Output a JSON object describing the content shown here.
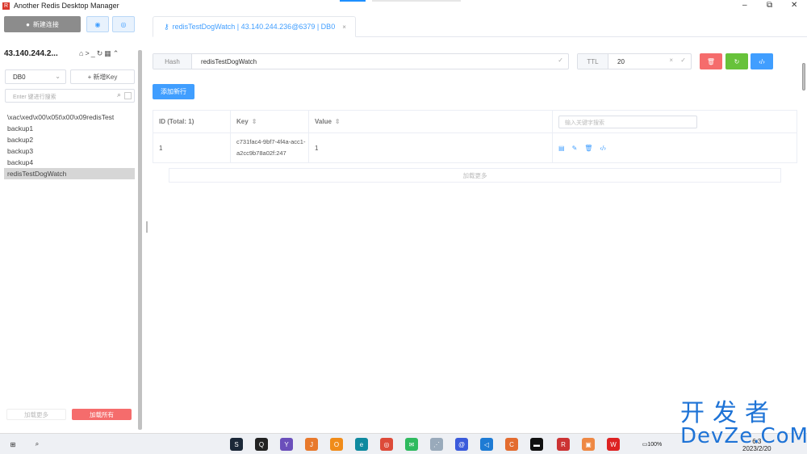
{
  "window": {
    "title": "Another Redis Desktop Manager",
    "app_icon": "redis-logo-icon"
  },
  "window_controls": {
    "minimize": "–",
    "maximize": "⧉",
    "close": "✕"
  },
  "sidebar": {
    "new_connection_label": "新建连接",
    "connection_name": "43.140.244.2...",
    "db_select": {
      "value": "DB0"
    },
    "new_key_label": "+ 新增Key",
    "key_search": {
      "placeholder": "Enter 键进行搜索"
    },
    "keys": [
      {
        "label": "\\xac\\xed\\x00\\x05t\\x00\\x09redisTest",
        "active": false
      },
      {
        "label": "backup1",
        "active": false
      },
      {
        "label": "backup2",
        "active": false
      },
      {
        "label": "backup3",
        "active": false
      },
      {
        "label": "backup4",
        "active": false
      },
      {
        "label": "redisTestDogWatch",
        "active": true
      }
    ],
    "load_more_label": "加载更多",
    "load_all_label": "加载所有"
  },
  "main": {
    "tab": {
      "label": "redisTestDogWatch | 43.140.244.236@6379 | DB0",
      "close": "×"
    },
    "key_type": "Hash",
    "key_name": "redisTestDogWatch",
    "ttl_label": "TTL",
    "ttl_value": "20",
    "add_row_label": "添加新行",
    "table": {
      "headers": {
        "id": "ID (Total: 1)",
        "key": "Key",
        "value": "Value"
      },
      "search_placeholder": "输入关键字搜索",
      "rows": [
        {
          "id": "1",
          "key": "c731fac4-9bf7-4f4a-acc1-a2cc9b78a02f:247",
          "value": "1"
        }
      ]
    },
    "load_more_label": "加载更多"
  },
  "taskbar": {
    "time": "6:3",
    "date": "2023/2/20",
    "battery": "100%"
  },
  "watermark": {
    "cn": "开发者",
    "en": "DevZe.CoM"
  },
  "colors": {
    "primary": "#409eff",
    "danger": "#f56c6c",
    "success": "#67c23a"
  }
}
